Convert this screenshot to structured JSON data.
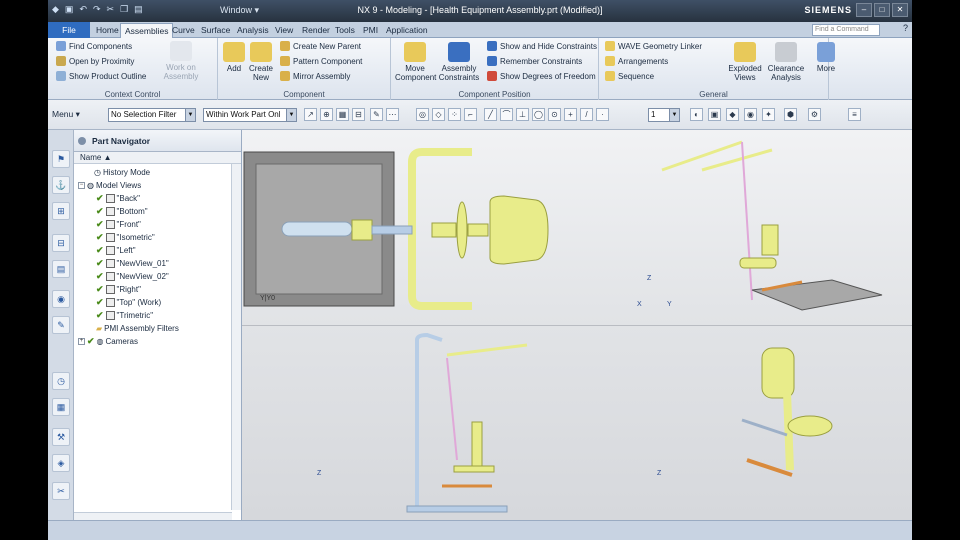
{
  "window": {
    "title": "NX 9 - Modeling - [Health Equipment Assembly.prt (Modified)]",
    "brand": "SIEMENS",
    "window_menu": "Window ▾"
  },
  "tabs": {
    "file": "File",
    "items": [
      "Home",
      "Assemblies",
      "Curve",
      "Surface",
      "Analysis",
      "View",
      "Render",
      "Tools",
      "PMI",
      "Application"
    ],
    "active": "Assemblies",
    "search_placeholder": "Find a Command",
    "help": "?"
  },
  "ribbon": {
    "context_control": {
      "label": "Context Control",
      "find_components": "Find Components",
      "open_by_proximity": "Open by Proximity",
      "show_product_outline": "Show Product Outline",
      "work_on_assembly": "Work on Assembly"
    },
    "component": {
      "label": "Component",
      "add": "Add",
      "create_new": "Create New",
      "create_new_parent": "Create New Parent",
      "pattern_component": "Pattern Component",
      "mirror_assembly": "Mirror Assembly"
    },
    "component_position": {
      "label": "Component Position",
      "move_component": "Move Component",
      "assembly_constraints": "Assembly Constraints",
      "show_hide_constraints": "Show and Hide Constraints",
      "remember_constraints": "Remember Constraints",
      "show_degrees_of_freedom": "Show Degrees of Freedom"
    },
    "general": {
      "label": "General",
      "wave_geometry_linker": "WAVE Geometry Linker",
      "arrangements": "Arrangements",
      "sequence": "Sequence",
      "exploded_views": "Exploded Views",
      "clearance_analysis": "Clearance Analysis",
      "more": "More"
    }
  },
  "toolbar": {
    "menu": "Menu ▾",
    "selection_filter": "No Selection Filter",
    "scope": "Within Work Part Onl",
    "layer_value": "1"
  },
  "navigator": {
    "title": "Part Navigator",
    "column_name": "Name",
    "items": [
      {
        "label": "History Mode",
        "level": 0
      },
      {
        "label": "Model Views",
        "level": 0
      },
      {
        "label": "\"Back\"",
        "level": 1
      },
      {
        "label": "\"Bottom\"",
        "level": 1
      },
      {
        "label": "\"Front\"",
        "level": 1
      },
      {
        "label": "\"Isometric\"",
        "level": 1
      },
      {
        "label": "\"Left\"",
        "level": 1
      },
      {
        "label": "\"NewView_01\"",
        "level": 1
      },
      {
        "label": "\"NewView_02\"",
        "level": 1
      },
      {
        "label": "\"Right\"",
        "level": 1
      },
      {
        "label": "\"Top\" (Work)",
        "level": 1
      },
      {
        "label": "\"Trimetric\"",
        "level": 1
      },
      {
        "label": "PMI Assembly Filters",
        "level": 1
      },
      {
        "label": "Cameras",
        "level": 0
      }
    ]
  },
  "viewports": {
    "top_view_axis": "Y|Y0",
    "axis_z": "Z",
    "axis_x": "X",
    "axis_y": "Y"
  },
  "colors": {
    "model_yellow": "#e8ec8a",
    "model_blue": "#b7cde6",
    "model_orange": "#d98a3c",
    "ribbon_accent": "#2f6cc0"
  }
}
